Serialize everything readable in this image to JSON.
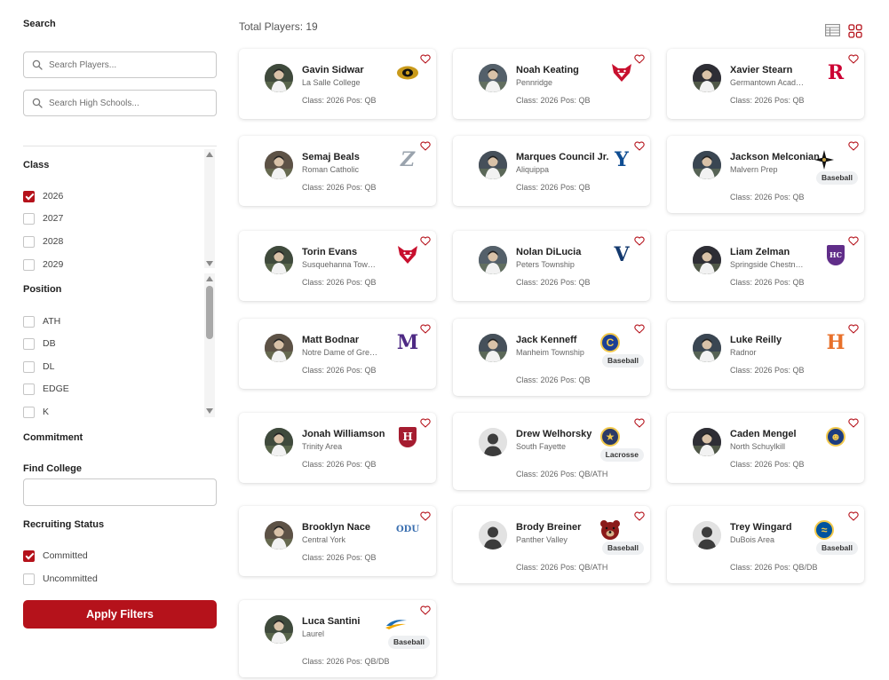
{
  "filters": {
    "search_title": "Search",
    "player_placeholder": "Search Players...",
    "school_placeholder": "Search High Schools...",
    "class_title": "Class",
    "class_options": [
      {
        "label": "2026",
        "checked": true
      },
      {
        "label": "2027",
        "checked": false
      },
      {
        "label": "2028",
        "checked": false
      },
      {
        "label": "2029",
        "checked": false
      }
    ],
    "position_title": "Position",
    "position_options": [
      {
        "label": "ATH",
        "checked": false
      },
      {
        "label": "DB",
        "checked": false
      },
      {
        "label": "DL",
        "checked": false
      },
      {
        "label": "EDGE",
        "checked": false
      },
      {
        "label": "K",
        "checked": false
      }
    ],
    "commitment_title": "Commitment",
    "find_college_title": "Find College",
    "find_college_value": "",
    "recruiting_title": "Recruiting Status",
    "recruiting_options": [
      {
        "label": "Committed",
        "checked": true
      },
      {
        "label": "Uncommitted",
        "checked": false
      }
    ],
    "apply_label": "Apply Filters"
  },
  "results": {
    "total_label": "Total Players: 19",
    "accent_color": "#b5121b",
    "view_icons": [
      "table-view-icon",
      "grid-view-icon"
    ]
  },
  "players": [
    {
      "name": "Gavin Sidwar",
      "school": "La Salle College",
      "info": "Class: 2026   Pos: QB",
      "badge": "",
      "photo": true,
      "logo": {
        "kind": "eye",
        "color": "#c99a1b"
      }
    },
    {
      "name": "Noah Keating",
      "school": "Pennridge",
      "info": "Class: 2026   Pos: QB",
      "badge": "",
      "photo": true,
      "logo": {
        "kind": "fox",
        "color": "#c8102e"
      }
    },
    {
      "name": "Xavier Stearn",
      "school": "Germantown Acad…",
      "info": "Class: 2026   Pos: QB",
      "badge": "",
      "photo": true,
      "logo": {
        "kind": "letter",
        "text": "R",
        "color": "#cc0033"
      }
    },
    {
      "name": "Semaj Beals",
      "school": "Roman Catholic",
      "info": "Class: 2026   Pos: QB",
      "badge": "",
      "photo": true,
      "logo": {
        "kind": "letter",
        "text": "Z",
        "color": "#9aa3ad",
        "italic": true
      }
    },
    {
      "name": "Marques Council Jr.",
      "school": "Aliquippa",
      "info": "Class: 2026   Pos: QB",
      "badge": "",
      "photo": true,
      "logo": {
        "kind": "letter",
        "text": "Y",
        "color": "#0f4d92"
      }
    },
    {
      "name": "Jackson Melconian",
      "school": "Malvern Prep",
      "info": "Class: 2026   Pos: QB",
      "badge": "Baseball",
      "photo": true,
      "logo": {
        "kind": "star",
        "color": "#111111"
      }
    },
    {
      "name": "Torin Evans",
      "school": "Susquehanna Tow…",
      "info": "Class: 2026   Pos: QB",
      "badge": "",
      "photo": true,
      "logo": {
        "kind": "fox",
        "color": "#c8102e"
      }
    },
    {
      "name": "Nolan DiLucia",
      "school": "Peters Township",
      "info": "Class: 2026   Pos: QB",
      "badge": "",
      "photo": true,
      "logo": {
        "kind": "letter",
        "text": "V",
        "color": "#13396e"
      }
    },
    {
      "name": "Liam Zelman",
      "school": "Springside Chestn…",
      "info": "Class: 2026   Pos: QB",
      "badge": "",
      "photo": true,
      "logo": {
        "kind": "shield",
        "text": "HC",
        "color": "#602d89"
      }
    },
    {
      "name": "Matt Bodnar",
      "school": "Notre Dame of Gre…",
      "info": "Class: 2026   Pos: QB",
      "badge": "",
      "photo": true,
      "logo": {
        "kind": "letter",
        "text": "M",
        "color": "#4e2a84"
      }
    },
    {
      "name": "Jack Kenneff",
      "school": "Manheim Township",
      "info": "Class: 2026   Pos: QB",
      "badge": "Baseball",
      "photo": true,
      "logo": {
        "kind": "round",
        "text": "C",
        "color": "#1c3f94"
      }
    },
    {
      "name": "Luke Reilly",
      "school": "Radnor",
      "info": "Class: 2026   Pos: QB",
      "badge": "",
      "photo": true,
      "logo": {
        "kind": "letter",
        "text": "H",
        "color": "#e8702a"
      }
    },
    {
      "name": "Jonah Williamson",
      "school": "Trinity Area",
      "info": "Class: 2026   Pos: QB",
      "badge": "",
      "photo": true,
      "logo": {
        "kind": "shield",
        "text": "H",
        "color": "#a51c30"
      }
    },
    {
      "name": "Drew Welhorsky",
      "school": "South Fayette",
      "info": "Class: 2026   Pos: QB/ATH",
      "badge": "Lacrosse",
      "photo": false,
      "logo": {
        "kind": "round",
        "text": "★",
        "color": "#2b3a67"
      }
    },
    {
      "name": "Caden Mengel",
      "school": "North Schuylkill",
      "info": "Class: 2026   Pos: QB",
      "badge": "",
      "photo": true,
      "logo": {
        "kind": "round",
        "text": "☻",
        "color": "#1b3c80"
      }
    },
    {
      "name": "Brooklyn Nace",
      "school": "Central York",
      "info": "Class: 2026   Pos: QB",
      "badge": "",
      "photo": true,
      "logo": {
        "kind": "letter",
        "text": "ODU",
        "color": "#3a6fb0",
        "small": true
      }
    },
    {
      "name": "Brody Breiner",
      "school": "Panther Valley",
      "info": "Class: 2026   Pos: QB/ATH",
      "badge": "Baseball",
      "photo": false,
      "logo": {
        "kind": "bear",
        "color": "#8b1a1a"
      }
    },
    {
      "name": "Trey Wingard",
      "school": "DuBois Area",
      "info": "Class: 2026   Pos: QB/DB",
      "badge": "Baseball",
      "photo": false,
      "logo": {
        "kind": "round",
        "text": "≈",
        "color": "#00539f"
      }
    },
    {
      "name": "Luca Santini",
      "school": "Laurel",
      "info": "Class: 2026   Pos: QB/DB",
      "badge": "Baseball",
      "photo": true,
      "logo": {
        "kind": "swoosh",
        "color": "#1f6fb5"
      }
    }
  ]
}
